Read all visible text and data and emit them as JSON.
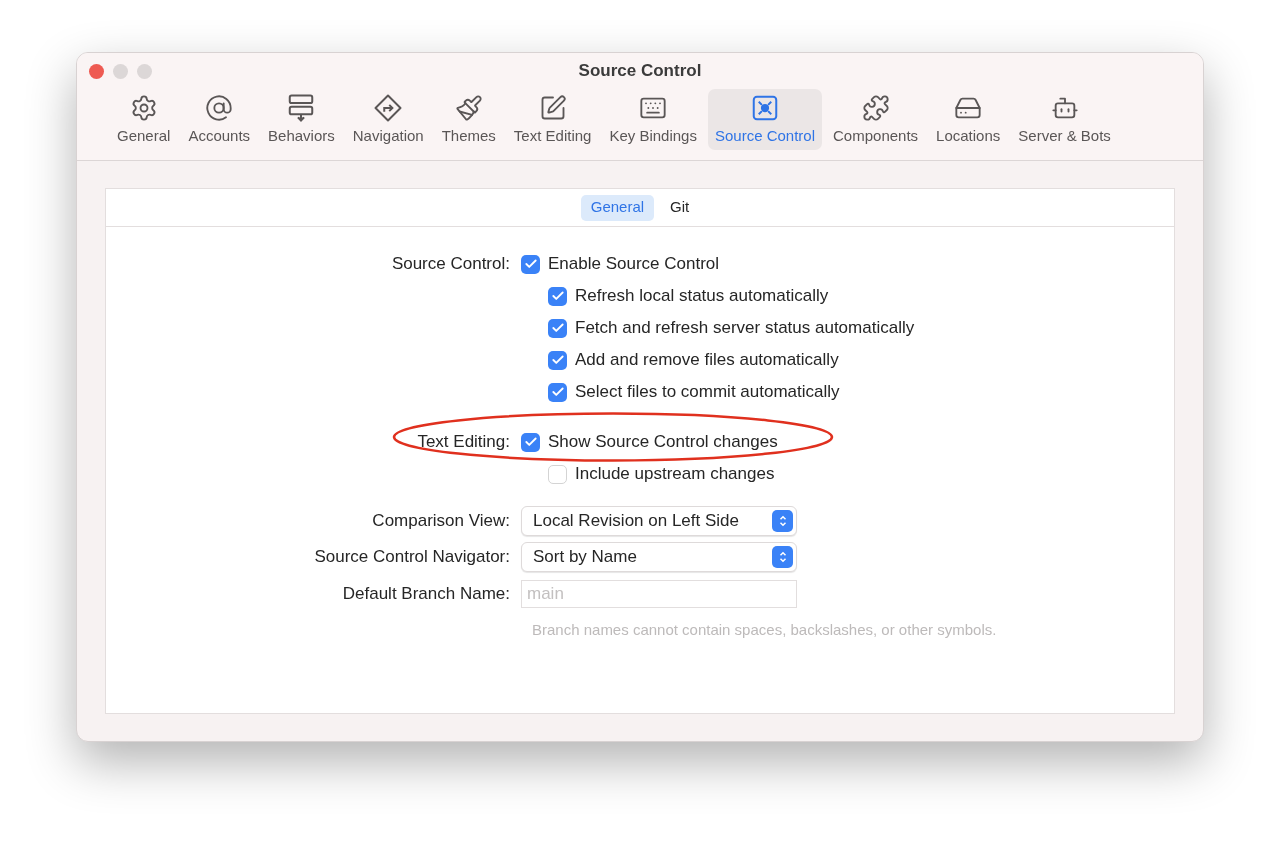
{
  "window": {
    "title": "Source Control"
  },
  "toolbar": [
    {
      "label": "General",
      "selected": false
    },
    {
      "label": "Accounts",
      "selected": false
    },
    {
      "label": "Behaviors",
      "selected": false
    },
    {
      "label": "Navigation",
      "selected": false
    },
    {
      "label": "Themes",
      "selected": false
    },
    {
      "label": "Text Editing",
      "selected": false
    },
    {
      "label": "Key Bindings",
      "selected": false
    },
    {
      "label": "Source Control",
      "selected": true
    },
    {
      "label": "Components",
      "selected": false
    },
    {
      "label": "Locations",
      "selected": false
    },
    {
      "label": "Server & Bots",
      "selected": false
    }
  ],
  "tabs": [
    {
      "label": "General",
      "selected": true
    },
    {
      "label": "Git",
      "selected": false
    }
  ],
  "checkbox_groups": [
    {
      "label": "Source Control:",
      "option": {
        "text": "Enable Source Control",
        "checked": true,
        "children": [
          {
            "text": "Refresh local status automatically",
            "checked": true
          },
          {
            "text": "Fetch and refresh server status automatically",
            "checked": true
          },
          {
            "text": "Add and remove files automatically",
            "checked": true
          },
          {
            "text": "Select files to commit automatically",
            "checked": true
          }
        ]
      }
    },
    {
      "label": "Text Editing:",
      "highlighted": true,
      "option": {
        "text": "Show Source Control changes",
        "checked": true,
        "children": [
          {
            "text": "Include upstream changes",
            "checked": false
          }
        ]
      }
    }
  ],
  "popups": [
    {
      "label": "Comparison View:",
      "value": "Local Revision on Left Side"
    },
    {
      "label": "Source Control Navigator:",
      "value": "Sort by Name"
    }
  ],
  "branch_field": {
    "label": "Default Branch Name:",
    "placeholder": "main",
    "hint": "Branch names cannot contain spaces, backslashes, or other symbols."
  }
}
